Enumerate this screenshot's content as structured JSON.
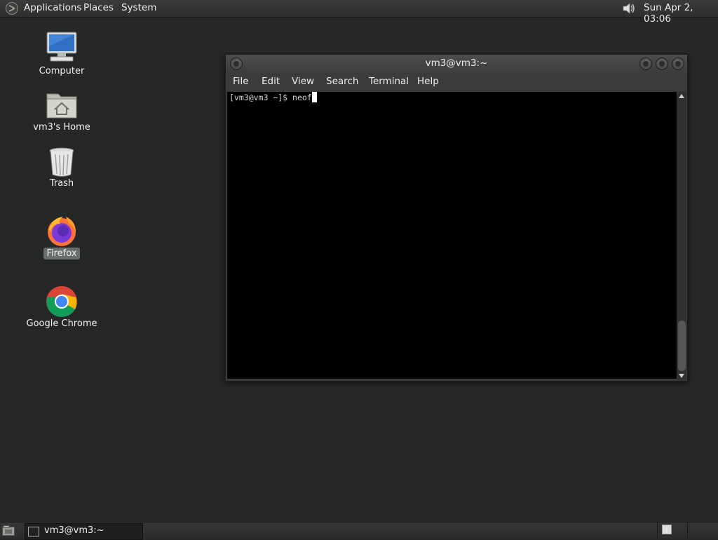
{
  "top_panel": {
    "menus": [
      "Applications",
      "Places",
      "System"
    ],
    "clock": "Sun Apr  2, 03:06",
    "icons": {
      "logo": "gnome-foot-icon",
      "sound": "speaker-icon"
    }
  },
  "desktop": {
    "icons": [
      {
        "label": "Computer",
        "icon": "computer-icon"
      },
      {
        "label": "vm3's Home",
        "icon": "home-folder-icon"
      },
      {
        "label": "Trash",
        "icon": "trash-icon"
      },
      {
        "label": "Firefox",
        "icon": "firefox-icon",
        "selected": true
      },
      {
        "label": "Google Chrome",
        "icon": "chrome-icon"
      }
    ]
  },
  "terminal": {
    "title": "vm3@vm3:~",
    "menu": [
      "File",
      "Edit",
      "View",
      "Search",
      "Terminal",
      "Help"
    ],
    "prompt": "[vm3@vm3 ~]$ ",
    "input": "neof"
  },
  "taskbar": {
    "tasks": [
      {
        "label": "vm3@vm3:~",
        "icon": "terminal-icon"
      }
    ]
  },
  "colors": {
    "desktop_bg": "#262727",
    "panel": "#333434",
    "terminal_bg": "#000000"
  }
}
